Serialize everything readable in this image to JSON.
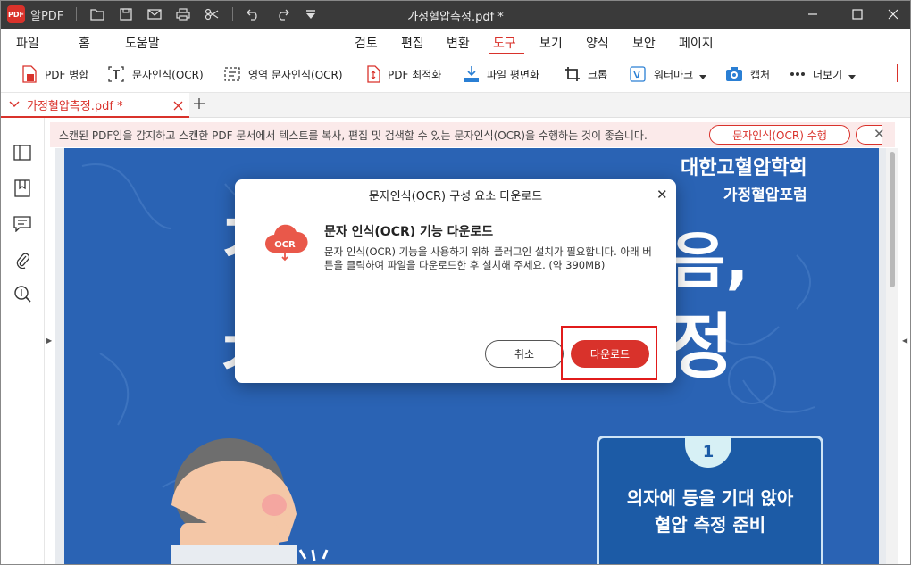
{
  "titlebar": {
    "app_name": "알PDF",
    "document_title": "가정혈압측정.pdf *",
    "icons": [
      "folder-icon",
      "save-icon",
      "mail-icon",
      "print-icon",
      "scissors-icon",
      "undo-icon",
      "redo-icon",
      "dropdown-icon"
    ]
  },
  "menu": {
    "left": [
      "파일",
      "홈",
      "도움말"
    ],
    "center": [
      "검토",
      "편집",
      "변환",
      "도구",
      "보기",
      "양식",
      "보안",
      "페이지"
    ],
    "active": "도구"
  },
  "toolbar": {
    "pdf_merge": "PDF 병합",
    "ocr": "문자인식(OCR)",
    "area_ocr": "영역 문자인식(OCR)",
    "pdf_optimize": "PDF 최적화",
    "flatten": "파일 평면화",
    "crop": "크롭",
    "watermark": "워터마크",
    "capture": "캡처",
    "more": "더보기"
  },
  "tab": {
    "title": "가정혈압측정.pdf *"
  },
  "notice": {
    "text": "스캔된 PDF임을 감지하고 스캔한 PDF 문서에서 텍스트를 복사, 편집 및 검색할 수 있는 문자인식(OCR)을 수행하는 것이 좋습니다.",
    "button": "문자인식(OCR) 수행"
  },
  "document": {
    "org_line1": "대한고혈압학회",
    "org_line2": "가정혈압포럼",
    "step_number": "1",
    "step_line1": "의자에 등을 기대 앉아",
    "step_line2": "혈압 측정 준비"
  },
  "dialog": {
    "title": "문자인식(OCR) 구성 요소 다운로드",
    "icon_label": "OCR",
    "heading": "문자 인식(OCR) 기능 다운로드",
    "body": "문자 인식(OCR) 기능을 사용하기 위해 플러그인 설치가 필요합니다. 아래 버튼을 클릭하여 파일을 다운로드한 후 설치해 주세요. (약 390MB)",
    "cancel": "취소",
    "download": "다운로드"
  },
  "colors": {
    "accent": "#d9322b",
    "titlebar": "#3a3a3a",
    "page_blue": "#2a63b4",
    "highlight": "#e11b1b"
  }
}
